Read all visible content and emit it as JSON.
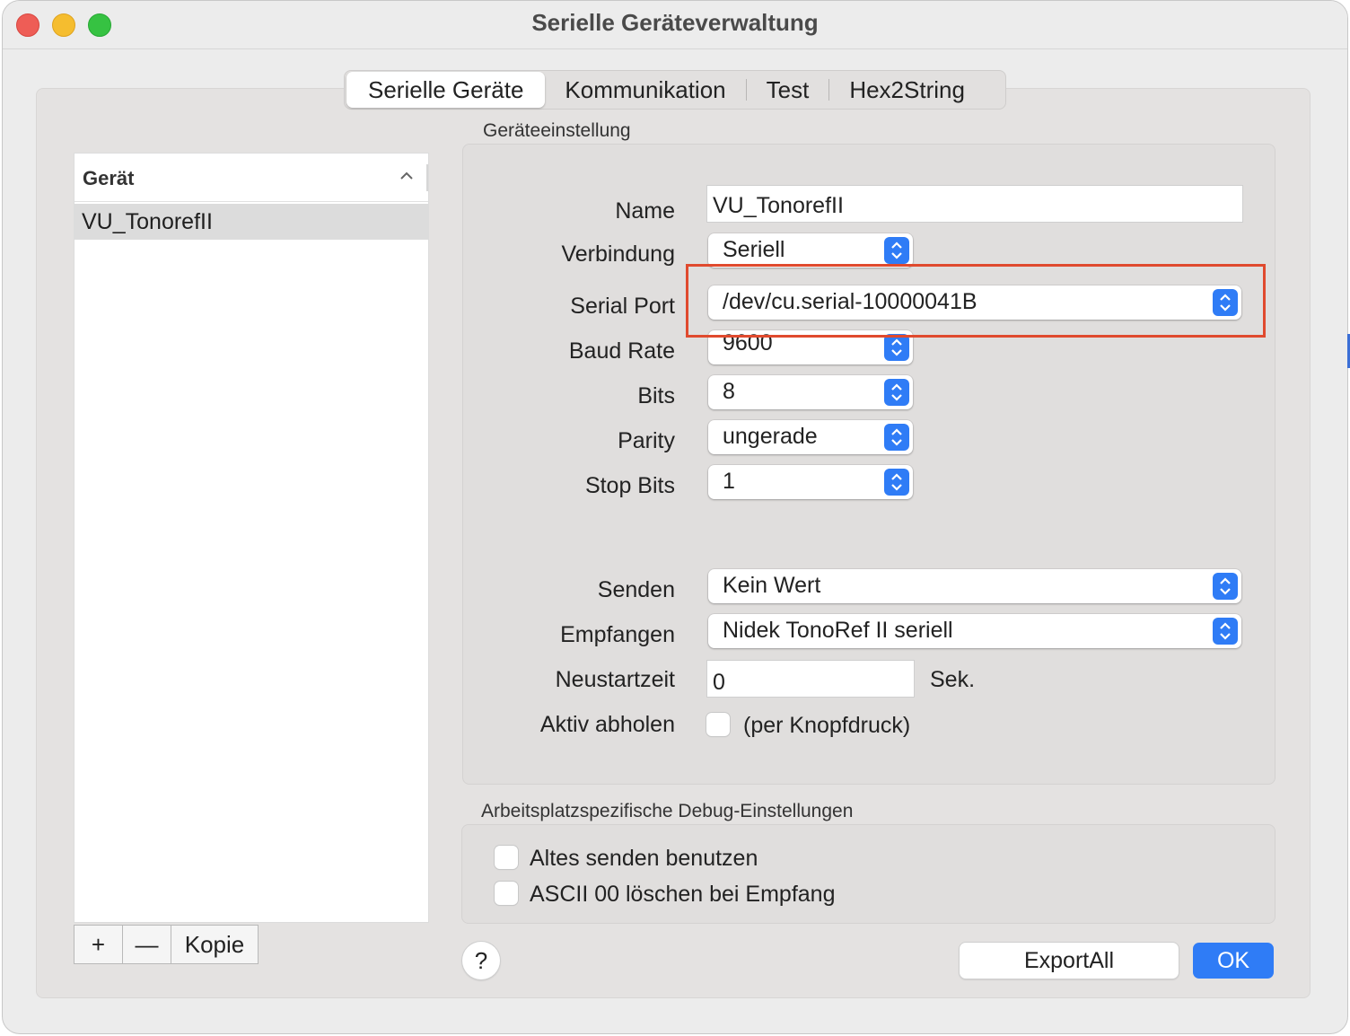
{
  "window": {
    "title": "Serielle Geräteverwaltung"
  },
  "tabs": [
    {
      "label": "Serielle Geräte",
      "active": true
    },
    {
      "label": "Kommunikation",
      "active": false
    },
    {
      "label": "Test",
      "active": false
    },
    {
      "label": "Hex2String",
      "active": false
    }
  ],
  "device_list": {
    "column_header": "Gerät",
    "rows": [
      "VU_TonorefII"
    ],
    "buttons": {
      "add": "+",
      "remove": "—",
      "copy": "Kopie"
    }
  },
  "device_settings": {
    "group_title": "Geräteeinstellung",
    "name": {
      "label": "Name",
      "value": "VU_TonorefII"
    },
    "connection": {
      "label": "Verbindung",
      "value": "Seriell"
    },
    "serial_port": {
      "label": "Serial Port",
      "value": "/dev/cu.serial-10000041B"
    },
    "baud_rate": {
      "label": "Baud Rate",
      "value": "9600"
    },
    "bits": {
      "label": "Bits",
      "value": "8"
    },
    "parity": {
      "label": "Parity",
      "value": "ungerade"
    },
    "stop_bits": {
      "label": "Stop Bits",
      "value": "1"
    },
    "send": {
      "label": "Senden",
      "value": "Kein Wert"
    },
    "receive": {
      "label": "Empfangen",
      "value": "Nidek TonoRef II seriell"
    },
    "restart_time": {
      "label": "Neustartzeit",
      "value": "0",
      "unit": "Sek."
    },
    "active_fetch": {
      "label": "Aktiv abholen",
      "checkbox_text": "(per Knopfdruck)",
      "checked": false
    }
  },
  "debug_settings": {
    "group_title": "Arbeitsplatzspezifische Debug-Einstellungen",
    "use_old_send": {
      "label": "Altes senden benutzen",
      "checked": false
    },
    "delete_ascii00": {
      "label": "ASCII 00 löschen bei Empfang",
      "checked": false
    }
  },
  "footer": {
    "help": "?",
    "export": "ExportAll",
    "ok": "OK"
  },
  "colors": {
    "accent": "#2f7cf6",
    "highlight_box": "#e04a2e"
  }
}
